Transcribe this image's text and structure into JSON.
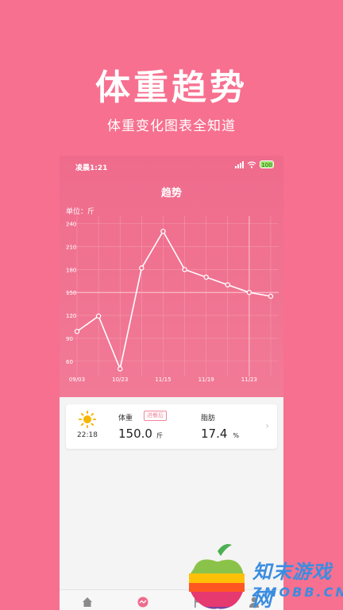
{
  "promo": {
    "title": "体重趋势",
    "subtitle": "体重变化图表全知道"
  },
  "status_bar": {
    "time": "凌晨1:21",
    "battery": "100"
  },
  "screen": {
    "title": "趋势",
    "unit_label": "单位：斤"
  },
  "chart_data": {
    "type": "line",
    "y_ticks": [
      "240",
      "210",
      "180",
      "150",
      "120",
      "90",
      "60"
    ],
    "ylim": [
      40,
      250
    ],
    "x_ticks": [
      "09/03",
      "10/23",
      "11/15",
      "11/19",
      "11/23"
    ],
    "x_tick_index": [
      0,
      2,
      4,
      6,
      8
    ],
    "values": [
      99,
      119,
      50,
      182,
      230,
      180,
      170,
      160,
      150,
      145
    ],
    "reference_y": 150,
    "colors": {
      "line": "#ffffff",
      "grid": "#f598ad"
    }
  },
  "record": {
    "time": "22:18",
    "weight_label": "体重",
    "meal_badge": "进餐后",
    "weight_value": "150.0",
    "weight_unit": "斤",
    "fat_label": "脂肪",
    "fat_value": "17.4",
    "fat_unit": "%"
  },
  "nav": {
    "items": [
      "home-icon",
      "trend-icon",
      "flag-icon",
      "user-icon"
    ],
    "active_color": "#ef6b8c"
  },
  "watermark": {
    "line1": "知末游戏网",
    "line2": "ZMOBB.CN"
  }
}
